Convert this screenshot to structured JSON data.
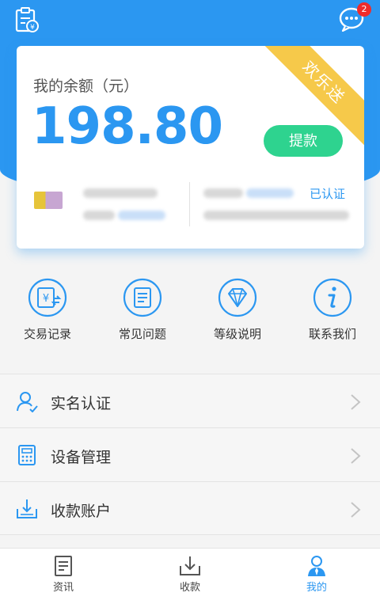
{
  "header": {
    "notification_count": "2"
  },
  "card": {
    "ribbon": "欢乐送",
    "balance_label": "我的余额（元）",
    "balance_value": "198.80",
    "withdraw_label": "提款",
    "verified_label": "已认证"
  },
  "grid": [
    {
      "label": "交易记录",
      "icon": "yen-exchange-icon"
    },
    {
      "label": "常见问题",
      "icon": "document-icon"
    },
    {
      "label": "等级说明",
      "icon": "diamond-icon"
    },
    {
      "label": "联系我们",
      "icon": "info-icon"
    }
  ],
  "menu": [
    {
      "label": "实名认证",
      "icon": "user-verify-icon"
    },
    {
      "label": "设备管理",
      "icon": "calculator-icon"
    },
    {
      "label": "收款账户",
      "icon": "download-tray-icon"
    }
  ],
  "nav": [
    {
      "label": "资讯",
      "icon": "news-icon"
    },
    {
      "label": "收款",
      "icon": "receive-icon"
    },
    {
      "label": "我的",
      "icon": "profile-icon"
    }
  ],
  "colors": {
    "brand_blue": "#2b97f1",
    "withdraw_green": "#2ed38f",
    "ribbon_yellow": "#f6c94a",
    "badge_red": "#ef2b2b"
  }
}
